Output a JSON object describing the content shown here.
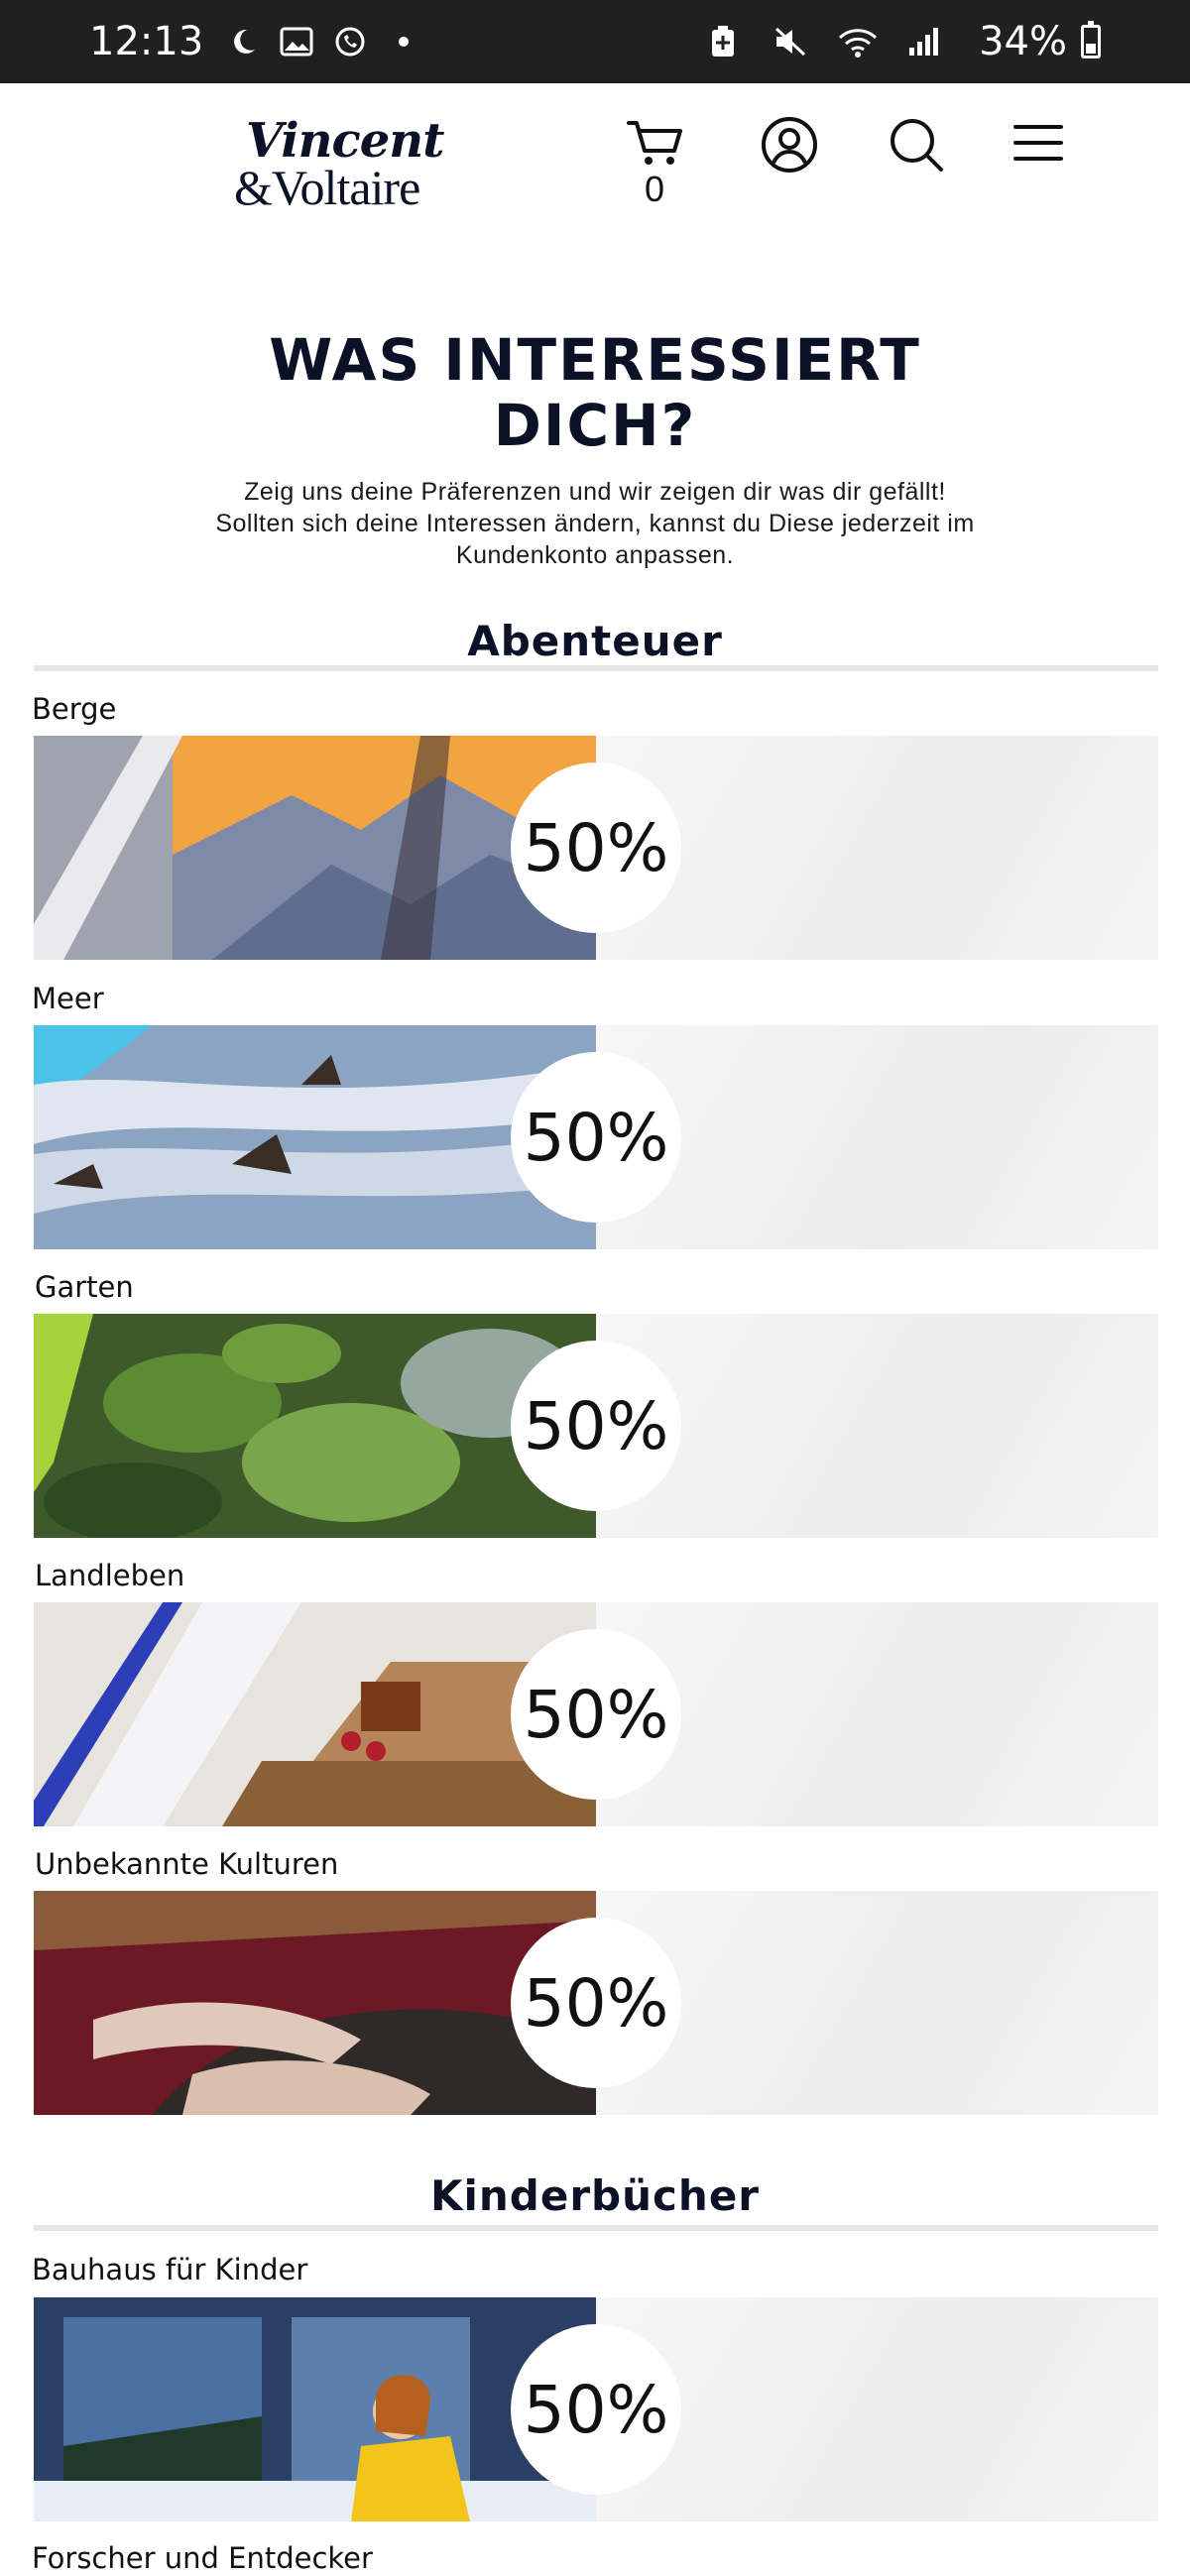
{
  "status_bar": {
    "time": "12:13",
    "battery": "34%",
    "icons": [
      "moon-icon",
      "gallery-icon",
      "whatsapp-icon",
      "dot-icon",
      "battery-saver-icon",
      "mute-icon",
      "wifi-icon",
      "signal-icon"
    ]
  },
  "header": {
    "logo_line1": "Vincent",
    "logo_line2": "&Voltaire",
    "cart_count": "0"
  },
  "intro": {
    "title_line1": "WAS INTERESSIERT",
    "title_line2": "DICH?",
    "desc_line1": "Zeig uns deine Präferenzen und wir zeigen dir was dir gefällt!",
    "desc_line2": "Sollten sich deine Interessen ändern, kannst du Diese jederzeit im",
    "desc_line3": "Kundenkonto anpassen."
  },
  "sections": [
    {
      "title": "Abenteuer",
      "items": [
        {
          "label": "Berge",
          "value": "50%"
        },
        {
          "label": "Meer",
          "value": "50%"
        },
        {
          "label": "Garten",
          "value": "50%"
        },
        {
          "label": "Landleben",
          "value": "50%"
        },
        {
          "label": "Unbekannte Kulturen",
          "value": "50%"
        }
      ]
    },
    {
      "title": "Kinderbücher",
      "items": [
        {
          "label": "Bauhaus für Kinder",
          "value": "50%"
        },
        {
          "label": "Forscher und Entdecker",
          "value": ""
        }
      ]
    }
  ]
}
